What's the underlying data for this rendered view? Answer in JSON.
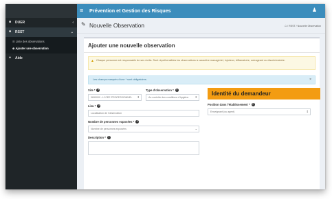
{
  "topbar": {
    "title": "Prévention et Gestion des Risques",
    "menu_icon": "hamburger-icon",
    "user_icon": "user-icon"
  },
  "sidebar": {
    "items": [
      {
        "label": "DUER",
        "icon": "briefcase-icon"
      },
      {
        "label": "RSST",
        "icon": "briefcase-icon"
      },
      {
        "label": "Aide",
        "icon": "question-icon"
      }
    ],
    "subitems": [
      {
        "label": "Liste des observations",
        "icon": "list-icon"
      },
      {
        "label": "Ajouter une observation",
        "icon": "plus-icon"
      }
    ]
  },
  "header": {
    "title": "Nouvelle Observation",
    "breadcrumb": [
      "RSST",
      "Nouvelle Observation"
    ]
  },
  "form": {
    "title": "Ajouter une nouvelle observation",
    "warning": "Chaque personne est responsable de ses écrits. Sont répréhensibles les observations à caractère managériel, injurieux, diffamatoire, outrageant ou discriminatoire.",
    "info": "Les champs marqués d'une * sont obligatoires.",
    "site_label": "Site *",
    "site_value": "0690000 - LYCEE PROFESSIONNEL",
    "type_label": "Type d'observation *",
    "type_value": "Au contrôle des conditions d'hygiène",
    "lieu_label": "Lieu *",
    "lieu_placeholder": "Localisation de l'observation",
    "persons_label": "Nombre de personnes exposées *",
    "persons_placeholder": "Nombre de personnes exposées",
    "description_label": "Description *"
  },
  "identity": {
    "title": "Identité du demandeur",
    "position_label": "Position dans l'établissement *",
    "position_value": "Enseignant (ou agent)"
  },
  "colors": {
    "topbar": "#3c8dbc",
    "sidebar": "#1f2528",
    "identity": "#f39c12",
    "warning_bg": "#fcf8e3",
    "info_bg": "#d9edf7"
  }
}
